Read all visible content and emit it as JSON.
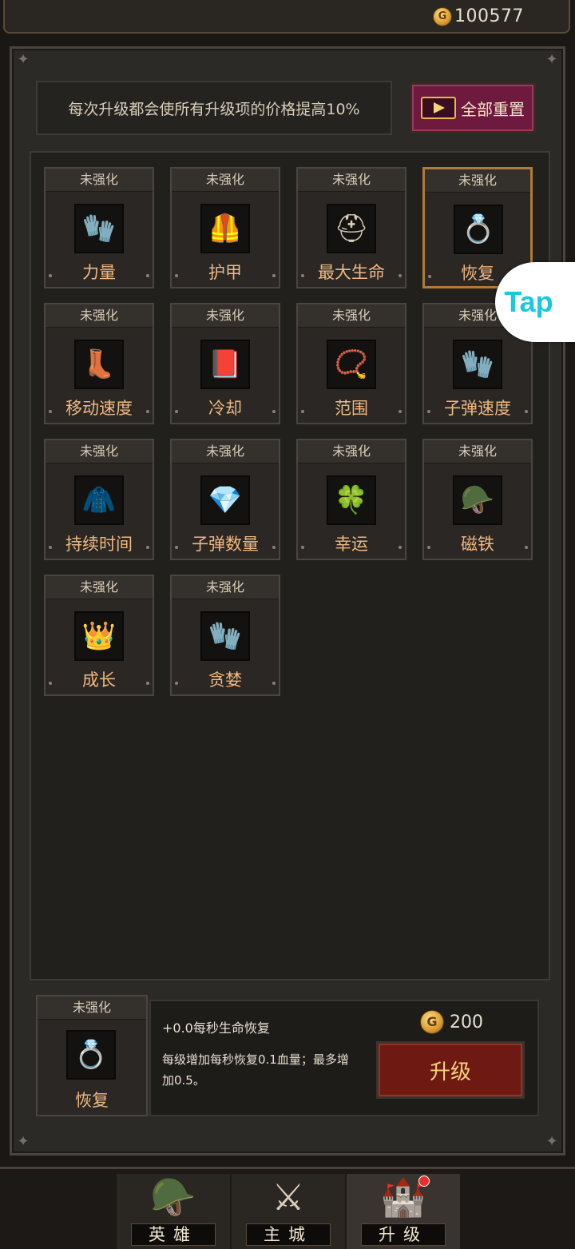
{
  "header": {
    "gold": "100577",
    "coin_glyph": "G"
  },
  "notice": "每次升级都会使所有升级项的价格提高10%",
  "reset_button": {
    "label": "全部重置",
    "icon": "video-play-icon"
  },
  "upgrades": [
    {
      "status": "未强化",
      "label": "力量",
      "icon": "🧤",
      "selected": false
    },
    {
      "status": "未强化",
      "label": "护甲",
      "icon": "🦺",
      "selected": false
    },
    {
      "status": "未强化",
      "label": "最大生命",
      "icon": "⛑",
      "selected": false
    },
    {
      "status": "未强化",
      "label": "恢复",
      "icon": "💍",
      "selected": true
    },
    {
      "status": "未强化",
      "label": "移动速度",
      "icon": "👢",
      "selected": false
    },
    {
      "status": "未强化",
      "label": "冷却",
      "icon": "📕",
      "selected": false
    },
    {
      "status": "未强化",
      "label": "范围",
      "icon": "📿",
      "selected": false
    },
    {
      "status": "未强化",
      "label": "子弹速度",
      "icon": "🧤",
      "selected": false
    },
    {
      "status": "未强化",
      "label": "持续时间",
      "icon": "🧥",
      "selected": false
    },
    {
      "status": "未强化",
      "label": "子弹数量",
      "icon": "💎",
      "selected": false
    },
    {
      "status": "未强化",
      "label": "幸运",
      "icon": "🍀",
      "selected": false
    },
    {
      "status": "未强化",
      "label": "磁铁",
      "icon": "🪖",
      "selected": false
    },
    {
      "status": "未强化",
      "label": "成长",
      "icon": "👑",
      "selected": false
    },
    {
      "status": "未强化",
      "label": "贪婪",
      "icon": "🧤",
      "selected": false
    }
  ],
  "tap_badge": "Tap",
  "detail": {
    "status": "未强化",
    "label": "恢复",
    "icon": "💍",
    "effect": "+0.0每秒生命恢复",
    "description": "每级增加每秒恢复0.1血量；最多增加0.5。",
    "cost": "200",
    "upgrade_label": "升级"
  },
  "nav": [
    {
      "label": "英雄",
      "icon": "hero-helmet-icon",
      "glyph": "🪖",
      "active": false,
      "badge": false
    },
    {
      "label": "主城",
      "icon": "crossed-swords-icon",
      "glyph": "⚔",
      "active": false,
      "badge": false
    },
    {
      "label": "升级",
      "icon": "castle-upgrade-icon",
      "glyph": "🏰",
      "active": true,
      "badge": true
    }
  ]
}
